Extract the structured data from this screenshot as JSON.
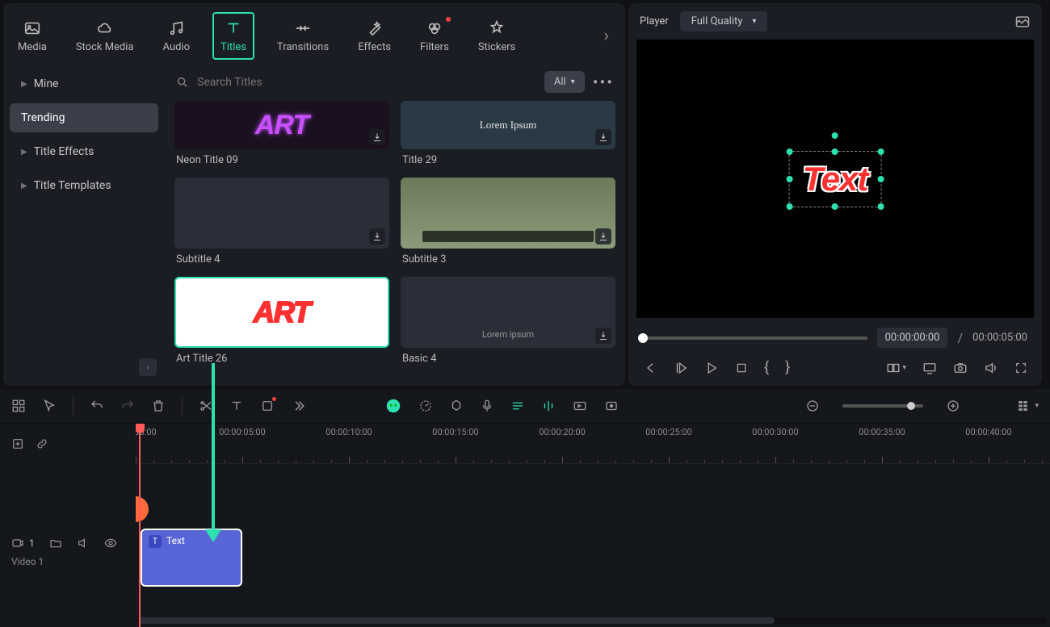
{
  "tabs": {
    "media": "Media",
    "stock": "Stock Media",
    "audio": "Audio",
    "titles": "Titles",
    "transitions": "Transitions",
    "effects": "Effects",
    "filters": "Filters",
    "stickers": "Stickers"
  },
  "sidebar": {
    "mine": "Mine",
    "trending": "Trending",
    "title_effects": "Title Effects",
    "title_templates": "Title Templates"
  },
  "search": {
    "placeholder": "Search Titles",
    "filter": "All"
  },
  "cards": {
    "neon": {
      "label": "Neon Title 09",
      "thumb": "ART"
    },
    "title29": {
      "label": "Title 29",
      "thumb": "Lorem Ipsum"
    },
    "sub4": {
      "label": "Subtitle 4"
    },
    "sub3": {
      "label": "Subtitle 3"
    },
    "art26": {
      "label": "Art Title 26",
      "thumb": "ART"
    },
    "basic4": {
      "label": "Basic 4",
      "thumb": "Lorem ipsum"
    }
  },
  "player": {
    "label": "Player",
    "quality": "Full Quality",
    "text_content": "Text",
    "time_current": "00:00:00:00",
    "time_sep": "/",
    "time_total": "00:00:05:00"
  },
  "ruler": {
    "t0": "00:00",
    "t1": "00:00:05:00",
    "t2": "00:00:10:00",
    "t3": "00:00:15:00",
    "t4": "00:00:20:00",
    "t5": "00:00:25:00",
    "t6": "00:00:30:00",
    "t7": "00:00:35:00",
    "t8": "00:00:40:00"
  },
  "track": {
    "count": "1",
    "name": "Video 1",
    "clip_label": "Text",
    "clip_icon": "T"
  }
}
